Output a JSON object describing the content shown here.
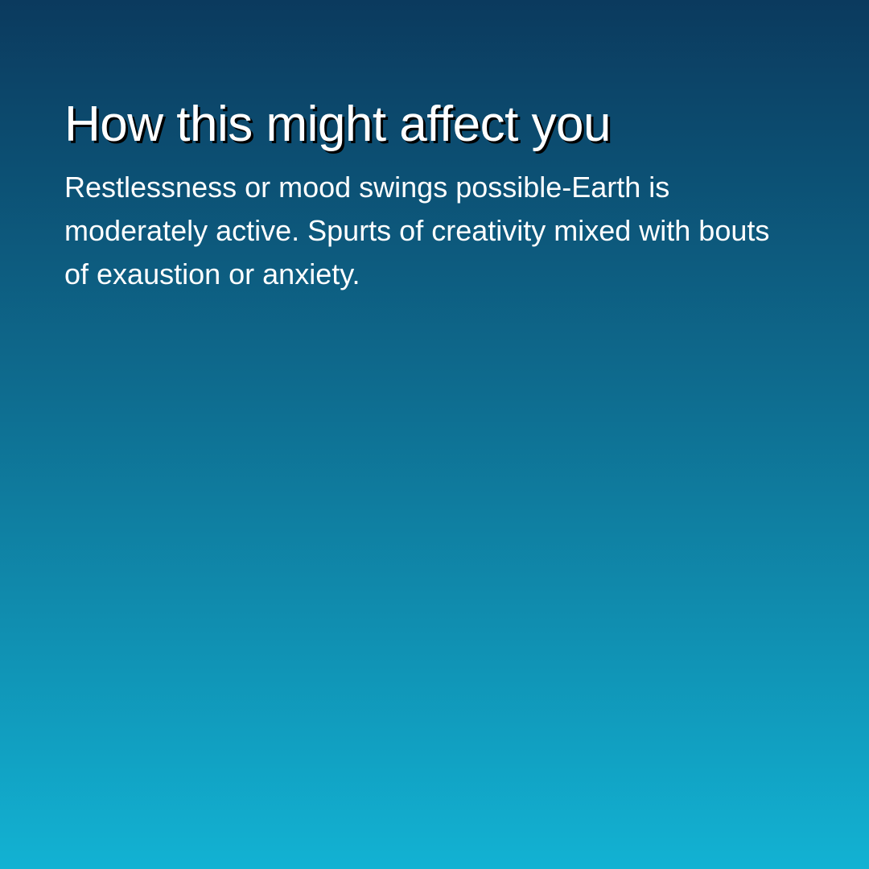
{
  "card": {
    "title": "How this might affect you",
    "body": "Restlessness or mood swings possible-Earth is moderately active. Spurts of creativity mixed with bouts of exaustion or anxiety."
  },
  "colors": {
    "gradient_top": "#0b3a5e",
    "gradient_mid": "#0e6c8f",
    "gradient_bottom": "#12b2d3",
    "text": "#ffffff",
    "title_shadow": "#000000"
  }
}
